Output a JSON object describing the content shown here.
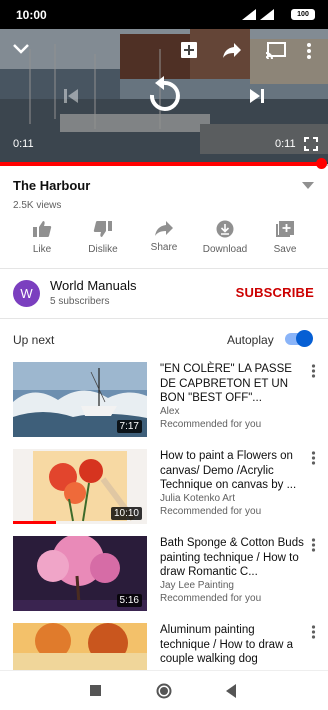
{
  "status_bar": {
    "time": "10:00",
    "battery": "100"
  },
  "player": {
    "time_elapsed": "0:11",
    "time_total": "0:11",
    "progress": 0.98,
    "icons": [
      "collapse-icon",
      "add-to-playlist-icon",
      "share-icon",
      "cast-icon",
      "more-vert-icon",
      "previous-icon",
      "replay-icon",
      "next-icon",
      "fullscreen-icon"
    ]
  },
  "video": {
    "title": "The Harbour",
    "views": "2.5K views"
  },
  "actions": [
    {
      "label": "Like",
      "icon": "thumb-up-icon"
    },
    {
      "label": "Dislike",
      "icon": "thumb-down-icon"
    },
    {
      "label": "Share",
      "icon": "share-icon"
    },
    {
      "label": "Download",
      "icon": "download-icon"
    },
    {
      "label": "Save",
      "icon": "save-icon"
    }
  ],
  "channel": {
    "avatar_letter": "W",
    "name": "World Manuals",
    "subscribers": "5 subscribers",
    "subscribe_label": "SUBSCRIBE",
    "avatar_color": "#7b3fbf"
  },
  "up_next": {
    "label": "Up next",
    "autoplay_label": "Autoplay",
    "autoplay_on": true
  },
  "videos": [
    {
      "title": "\"EN COLÈRE\" LA PASSE DE CAPBRETON ET UN BON \"BEST OFF\"...",
      "channel": "Alex",
      "note": "Recommended for you",
      "duration": "7:17"
    },
    {
      "title": "How to paint a Flowers on canvas/ Demo /Acrylic Technique on canvas by ...",
      "channel": "Julia Kotenko Art",
      "note": "Recommended for you",
      "duration": "10:10",
      "watched": 0.32
    },
    {
      "title": "Bath Sponge & Cotton Buds painting technique / How to draw Romantic C...",
      "channel": "Jay Lee Painting",
      "note": "Recommended for you",
      "duration": "5:16"
    },
    {
      "title": "Aluminum painting technique / How to draw a couple walking dog",
      "channel": "",
      "note": "",
      "duration": ""
    }
  ],
  "colors": {
    "accent_red": "#ff0000",
    "subscribe_red": "#cc0000",
    "toggle_blue": "#065fd4"
  }
}
